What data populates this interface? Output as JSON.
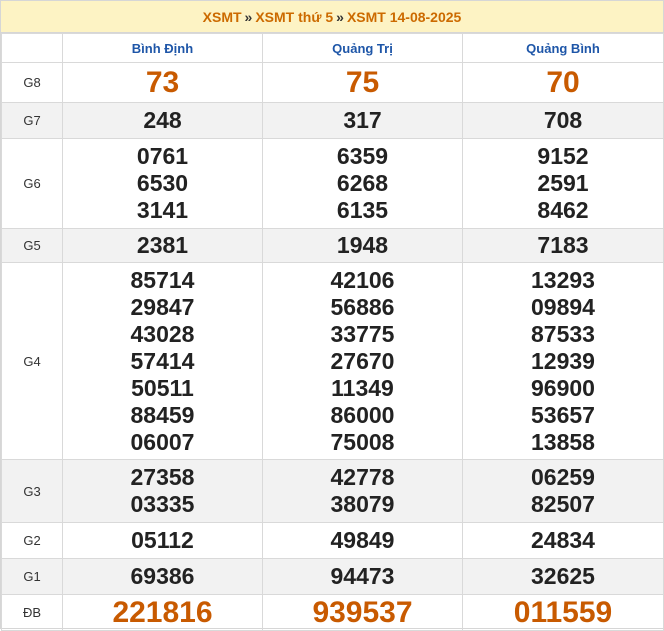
{
  "breadcrumb": {
    "items": [
      "XSMT",
      "XSMT thứ 5",
      "XSMT 14-08-2025"
    ],
    "separator": "»"
  },
  "provinces": [
    "Bình Định",
    "Quảng Trị",
    "Quảng Bình"
  ],
  "prizes": [
    {
      "label": "G8",
      "values": [
        [
          "73"
        ],
        [
          "75"
        ],
        [
          "70"
        ]
      ]
    },
    {
      "label": "G7",
      "values": [
        [
          "248"
        ],
        [
          "317"
        ],
        [
          "708"
        ]
      ]
    },
    {
      "label": "G6",
      "values": [
        [
          "0761",
          "6530",
          "3141"
        ],
        [
          "6359",
          "6268",
          "6135"
        ],
        [
          "9152",
          "2591",
          "8462"
        ]
      ]
    },
    {
      "label": "G5",
      "values": [
        [
          "2381"
        ],
        [
          "1948"
        ],
        [
          "7183"
        ]
      ]
    },
    {
      "label": "G4",
      "values": [
        [
          "85714",
          "29847",
          "43028",
          "57414",
          "50511",
          "88459",
          "06007"
        ],
        [
          "42106",
          "56886",
          "33775",
          "27670",
          "11349",
          "86000",
          "75008"
        ],
        [
          "13293",
          "09894",
          "87533",
          "12939",
          "96900",
          "53657",
          "13858"
        ]
      ]
    },
    {
      "label": "G3",
      "values": [
        [
          "27358",
          "03335"
        ],
        [
          "42778",
          "38079"
        ],
        [
          "06259",
          "82507"
        ]
      ]
    },
    {
      "label": "G2",
      "values": [
        [
          "05112"
        ],
        [
          "49849"
        ],
        [
          "24834"
        ]
      ]
    },
    {
      "label": "G1",
      "values": [
        [
          "69386"
        ],
        [
          "94473"
        ],
        [
          "32625"
        ]
      ]
    },
    {
      "label": "ĐB",
      "values": [
        [
          "221816"
        ],
        [
          "939537"
        ],
        [
          "011559"
        ]
      ]
    }
  ],
  "colors": {
    "accent": "#cc6a00",
    "province": "#1e56a8",
    "crumb_bg": "#fdf3c4",
    "shade": "#f2f2f2"
  }
}
